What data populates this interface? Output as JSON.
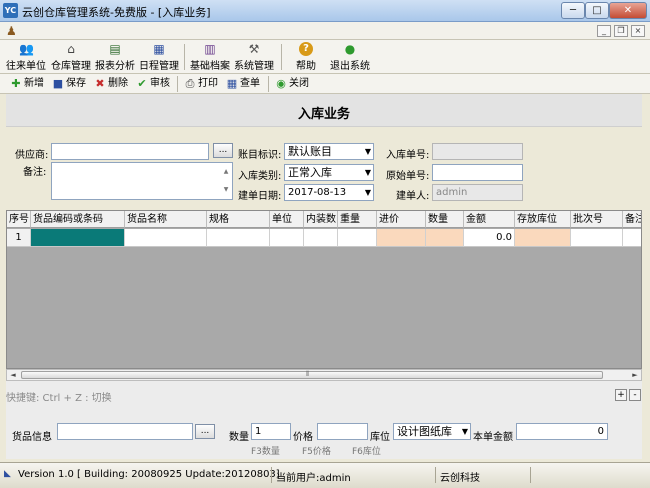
{
  "window": {
    "title": "云创仓库管理系统-免费版 - [入库业务]",
    "icon_text": "YC",
    "min_glyph": "─",
    "max_glyph": "□",
    "close_glyph": "✕"
  },
  "mdi_controls": {
    "min": "_",
    "restore": "❐",
    "close": "×"
  },
  "main_toolbar": [
    {
      "label": "往来单位",
      "icon": "users-icon",
      "glyph": "👥"
    },
    {
      "label": "仓库管理",
      "icon": "warehouse-icon",
      "glyph": "⌂"
    },
    {
      "label": "报表分析",
      "icon": "report-icon",
      "glyph": "▤"
    },
    {
      "label": "日程管理",
      "icon": "calendar-icon",
      "glyph": "▦"
    },
    {
      "label": "基础档案",
      "icon": "archive-icon",
      "glyph": "▥"
    },
    {
      "label": "系统管理",
      "icon": "tools-icon",
      "glyph": "⚒"
    },
    {
      "label": "帮助",
      "icon": "help-icon",
      "glyph": "?"
    },
    {
      "label": "退出系统",
      "icon": "exit-icon",
      "glyph": "●"
    }
  ],
  "small_toolbar": [
    {
      "label": "新增",
      "icon": "add-icon",
      "glyph": "✚",
      "color": "#2e9a2e"
    },
    {
      "label": "保存",
      "icon": "save-icon",
      "glyph": "■",
      "color": "#2d4fa0"
    },
    {
      "label": "删除",
      "icon": "delete-icon",
      "glyph": "✖",
      "color": "#c62d2d"
    },
    {
      "label": "审核",
      "icon": "check-icon",
      "glyph": "✔",
      "color": "#2e9a2e"
    },
    {
      "label": "打印",
      "icon": "print-icon",
      "glyph": "⎙",
      "color": "#444444"
    },
    {
      "label": "查单",
      "icon": "lookup-icon",
      "glyph": "▦",
      "color": "#2d4fa0"
    },
    {
      "label": "关闭",
      "icon": "close-icon",
      "glyph": "◉",
      "color": "#2e9a2e"
    }
  ],
  "page_heading": "入库业务",
  "form": {
    "supplier_label": "供应商:",
    "supplier_value": "",
    "ellipsis": "...",
    "remark_label": "备注:",
    "remark_value": "",
    "account_label": "账目标识:",
    "account_value": "默认账目",
    "type_label": "入库类别:",
    "type_value": "正常入库",
    "date_label": "建单日期:",
    "date_value": "2017-08-13",
    "in_no_label": "入库单号:",
    "in_no_value": "",
    "orig_no_label": "原始单号:",
    "orig_no_value": "",
    "creator_label": "建单人:",
    "creator_value": "admin"
  },
  "grid": {
    "columns": [
      "序号",
      "货品编码或条码",
      "货品名称",
      "规格",
      "单位",
      "内装数",
      "重量",
      "进价",
      "数量",
      "金额",
      "存放库位",
      "批次号",
      "备注"
    ],
    "rows": [
      [
        "1",
        "",
        "",
        "",
        "",
        "",
        "",
        "",
        "",
        "0.0",
        "",
        "",
        ""
      ]
    ]
  },
  "scroll": {
    "left": "◄",
    "right": "►",
    "thumb_grip": "⦀"
  },
  "shortcut_hint": "快捷键: Ctrl + Z : 切换",
  "pm_buttons": [
    "+",
    "-"
  ],
  "bottom": {
    "item_label": "货品信息",
    "item_value": "",
    "ellipsis": "...",
    "qty_label": "数量",
    "qty_value": "1",
    "price_label": "价格",
    "price_value": "",
    "location_label": "库位",
    "location_value": "设计图纸库",
    "total_label": "本单金额",
    "total_value": "0",
    "f3": "F3数量",
    "f5": "F5价格",
    "f6": "F6库位"
  },
  "status": {
    "version": "Version 1.0 [ Building: 20080925 Update:20120803]",
    "user": "当前用户:admin",
    "company": "云创科技"
  },
  "colors": {
    "code_cell": "#0a7a78",
    "price_cell": "#fad9bd",
    "title_grad": "#a9c7ea"
  }
}
